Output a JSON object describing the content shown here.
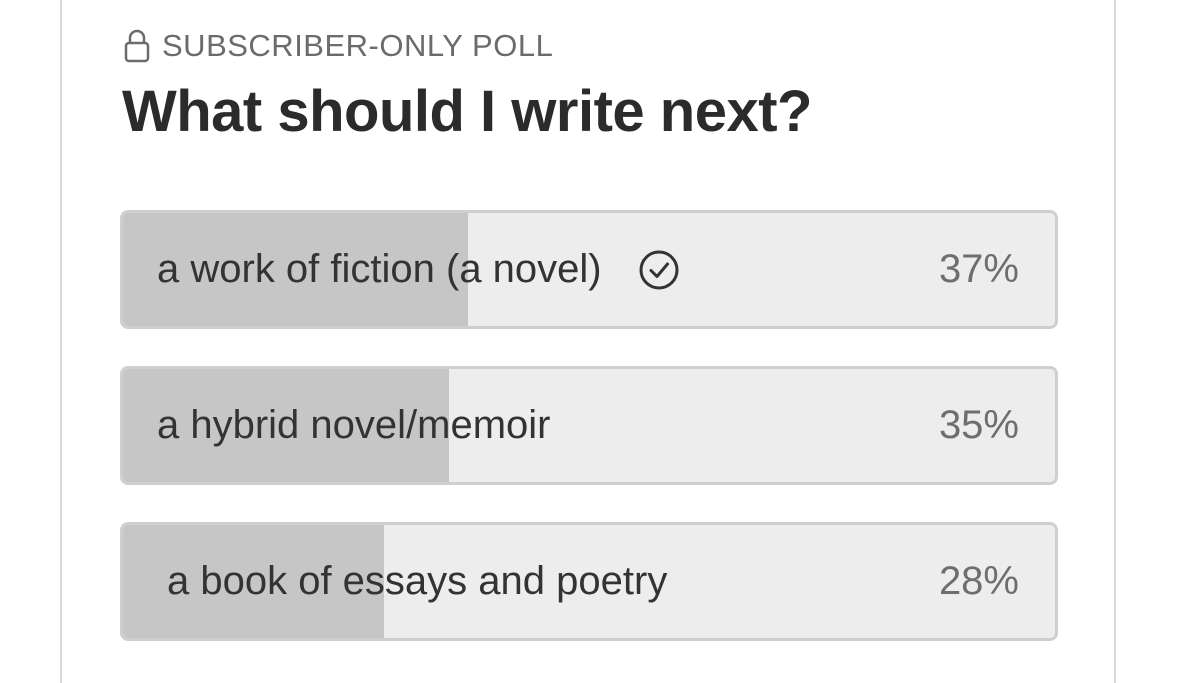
{
  "poll": {
    "tag": "SUBSCRIBER-ONLY POLL",
    "tag_icon": "lock-icon",
    "title": "What should I write next?",
    "options": [
      {
        "label": "a work of fiction (a novel)",
        "percent_label": "37%",
        "fraction": 0.37,
        "selected": true,
        "selected_icon": "check-circle-icon"
      },
      {
        "label": "a hybrid novel/memoir",
        "percent_label": "35%",
        "fraction": 0.35,
        "selected": false
      },
      {
        "label": "a book of essays and poetry",
        "percent_label": "28%",
        "fraction": 0.28,
        "selected": false
      }
    ]
  },
  "colors": {
    "fill": "#c6c6c6",
    "track": "#ededed",
    "border": "#cfcfcf",
    "title": "#2b2b2b",
    "tag": "#6b6b6b",
    "percent": "#6e6e6e"
  }
}
